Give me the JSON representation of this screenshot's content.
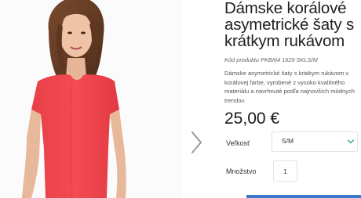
{
  "product": {
    "title": "Dámske korálové asymetrické šaty s krátkym rukávom",
    "sku": "Kód produktu PKBI64 1629 SKLS/M",
    "description": "Dámske asymetrické šaty s krátkym rukávom v korálovej farbe, vyrobené z vysoko kvalitného materiálu a navrhnuté podľa najnovších módnych trendov.",
    "price": "25,00 €",
    "dress_color": "#f0464e"
  },
  "options": {
    "size_label": "Veľkosť",
    "size_value": "S/M",
    "quantity_label": "Množstvo",
    "quantity_value": "1"
  },
  "gallery": {
    "next_icon": "chevron-right-icon"
  },
  "colors": {
    "accent": "#3a78c9",
    "chevron": "#3ba596"
  }
}
